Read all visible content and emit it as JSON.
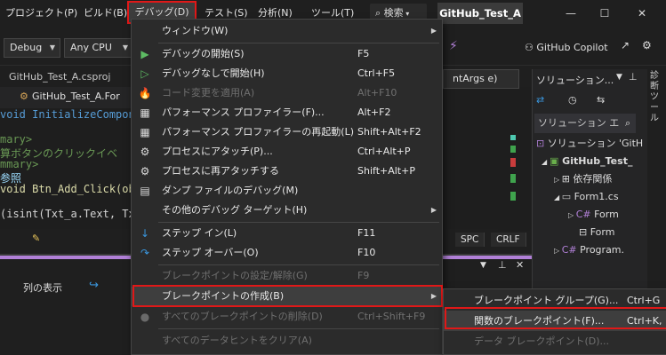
{
  "menubar": {
    "items": [
      "プロジェクト(P)",
      "ビルド(B)",
      "デバッグ(D)",
      "テスト(S)",
      "分析(N)",
      "ツール(T)"
    ],
    "search_label": "検索",
    "solution_name": "GitHub_Test_A",
    "window_controls": [
      "—",
      "☐",
      "✕"
    ]
  },
  "toolbar": {
    "config": "Debug",
    "platform": "Any CPU",
    "copilot": "GitHub Copilot"
  },
  "editor": {
    "tab": "GitHub_Test_A.csproj",
    "file_combo": "GitHub_Test_A.For",
    "lines": [
      "void InitializeCompon",
      "mary>",
      "算ボタンのクリックイベ",
      "mmary>",
      "参照",
      "void Btn_Add_Click(ob",
      "(isint(Txt_a.Text, Tx"
    ],
    "args_combo": "ntArgs e)",
    "status_buttons": [
      "SPC",
      "CRLF"
    ],
    "col_display": "列の表示"
  },
  "solution_explorer": {
    "title": "ソリューション...",
    "search": "ソリューション エ",
    "tree": [
      "ソリューション 'GitH",
      "GitHub_Test_",
      "依存関係",
      "Form1.cs",
      "Form",
      "Form",
      "Program."
    ],
    "side_label": "診断ツール"
  },
  "debug_menu": {
    "items": [
      {
        "label": "ウィンドウ(W)",
        "shortcut": "",
        "icon": "",
        "submenu": true,
        "disabled": false
      },
      {
        "label": "デバッグの開始(S)",
        "shortcut": "F5",
        "icon": "▶",
        "submenu": false,
        "disabled": false
      },
      {
        "label": "デバッグなしで開始(H)",
        "shortcut": "Ctrl+F5",
        "icon": "▷",
        "submenu": false,
        "disabled": false
      },
      {
        "label": "コード変更を適用(A)",
        "shortcut": "Alt+F10",
        "icon": "🔥",
        "submenu": false,
        "disabled": true
      },
      {
        "label": "パフォーマンス プロファイラー(F)...",
        "shortcut": "Alt+F2",
        "icon": "▦",
        "submenu": false,
        "disabled": false
      },
      {
        "label": "パフォーマンス プロファイラーの再起動(L)",
        "shortcut": "Shift+Alt+F2",
        "icon": "▦",
        "submenu": false,
        "disabled": false
      },
      {
        "label": "プロセスにアタッチ(P)...",
        "shortcut": "Ctrl+Alt+P",
        "icon": "⚙",
        "submenu": false,
        "disabled": false
      },
      {
        "label": "プロセスに再アタッチする",
        "shortcut": "Shift+Alt+P",
        "icon": "⚙",
        "submenu": false,
        "disabled": false
      },
      {
        "label": "ダンプ ファイルのデバッグ(M)",
        "shortcut": "",
        "icon": "▤",
        "submenu": false,
        "disabled": false
      },
      {
        "label": "その他のデバッグ ターゲット(H)",
        "shortcut": "",
        "icon": "",
        "submenu": true,
        "disabled": false
      },
      {
        "label": "ステップ イン(L)",
        "shortcut": "F11",
        "icon": "↓",
        "submenu": false,
        "disabled": false
      },
      {
        "label": "ステップ オーバー(O)",
        "shortcut": "F10",
        "icon": "↷",
        "submenu": false,
        "disabled": false
      },
      {
        "label": "ブレークポイントの設定/解除(G)",
        "shortcut": "F9",
        "icon": "",
        "submenu": false,
        "disabled": true
      },
      {
        "label": "ブレークポイントの作成(B)",
        "shortcut": "",
        "icon": "",
        "submenu": true,
        "disabled": false
      },
      {
        "label": "すべてのブレークポイントの削除(D)",
        "shortcut": "Ctrl+Shift+F9",
        "icon": "●",
        "submenu": false,
        "disabled": true
      },
      {
        "label": "すべてのデータヒントをクリア(A)",
        "shortcut": "",
        "icon": "",
        "submenu": false,
        "disabled": true
      }
    ]
  },
  "breakpoint_submenu": {
    "items": [
      {
        "label": "ブレークポイント グループ(G)...",
        "shortcut": "Ctrl+G",
        "disabled": false
      },
      {
        "label": "関数のブレークポイント(F)...",
        "shortcut": "Ctrl+K,",
        "disabled": false
      },
      {
        "label": "データ ブレークポイント(D)...",
        "shortcut": "",
        "disabled": true
      }
    ]
  },
  "colors": {
    "highlight_box": "#e01818",
    "accent_purple": "#b180d7",
    "play_green": "#5dbb63",
    "step_blue": "#3a96dd"
  }
}
